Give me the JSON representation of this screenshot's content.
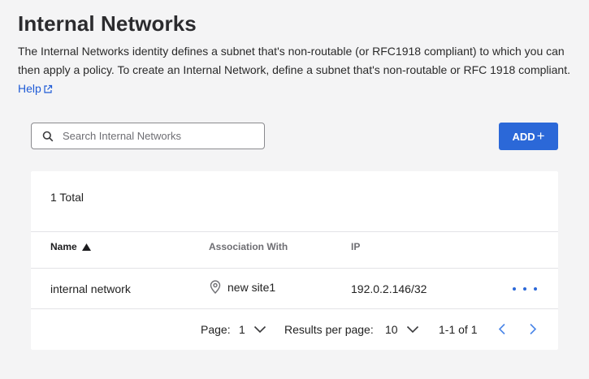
{
  "page": {
    "title": "Internal Networks",
    "description": "The Internal Networks identity defines a subnet that's non-routable (or RFC1918 compliant) to which you can then apply a policy. To create an Internal Network, define a subnet that's non-routable or RFC 1918 compliant.",
    "help_label": "Help"
  },
  "search": {
    "placeholder": "Search Internal Networks",
    "value": ""
  },
  "toolbar": {
    "add_label": "ADD",
    "add_icon": "+"
  },
  "table": {
    "total_label": "1 Total",
    "columns": {
      "name": "Name",
      "association": "Association With",
      "ip": "IP"
    },
    "sort": {
      "column": "Name",
      "direction": "ascending"
    },
    "rows": [
      {
        "name": "internal network",
        "association": "new site1",
        "ip": "192.0.2.146/32"
      }
    ]
  },
  "pagination": {
    "page_label": "Page:",
    "page_value": "1",
    "results_label": "Results per page:",
    "results_value": "10",
    "range": "1-1 of 1"
  },
  "colors": {
    "accent": "#2b68d8",
    "link": "#1f5bd6",
    "background": "#f4f4f5"
  },
  "icons": [
    "search-icon",
    "external-link-icon",
    "sort-ascending-icon",
    "location-pin-icon",
    "more-actions-icon",
    "chevron-down-icon",
    "chevron-left-icon",
    "chevron-right-icon"
  ]
}
